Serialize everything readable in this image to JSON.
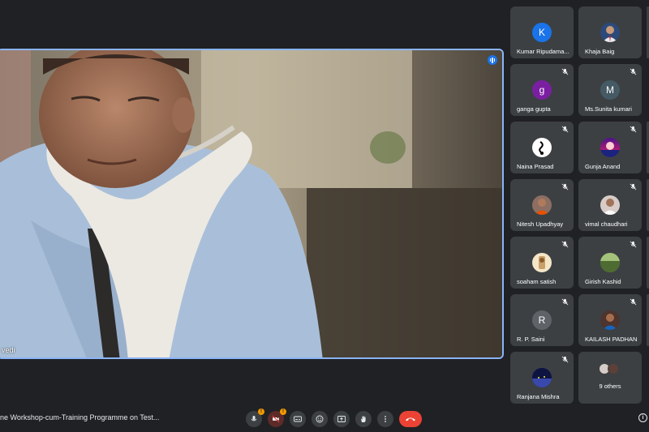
{
  "main_speaker": {
    "name_partial": "vedi"
  },
  "participants": [
    {
      "name": "Kumar Ripudama...",
      "initial": "K",
      "avatar_color": "#1a73e8",
      "muted": false,
      "photo": false
    },
    {
      "name": "Khaja Baig",
      "initial": "",
      "avatar_color": "#2b4a7a",
      "muted": false,
      "photo": true
    },
    {
      "name": "ganga gupta",
      "initial": "g",
      "avatar_color": "#7b1fa2",
      "muted": true,
      "photo": false
    },
    {
      "name": "Ms.Sunita kumari",
      "initial": "M",
      "avatar_color": "#455a64",
      "muted": true,
      "photo": false
    },
    {
      "name": "Naina Prasad",
      "initial": "",
      "avatar_color": "#ffffff",
      "muted": true,
      "photo": true
    },
    {
      "name": "Gunja Anand",
      "initial": "",
      "avatar_color": "#c2185b",
      "muted": true,
      "photo": true
    },
    {
      "name": "Nitesh Upadhyay",
      "initial": "",
      "avatar_color": "#8d6e63",
      "muted": true,
      "photo": true
    },
    {
      "name": "vimal chaudhari",
      "initial": "",
      "avatar_color": "#a1887f",
      "muted": true,
      "photo": true
    },
    {
      "name": "soaham satish",
      "initial": "",
      "avatar_color": "#c9a06a",
      "muted": true,
      "photo": true
    },
    {
      "name": "Girish Kashid",
      "initial": "",
      "avatar_color": "#6d8a4a",
      "muted": true,
      "photo": true
    },
    {
      "name": "R. P. Saini",
      "initial": "R",
      "avatar_color": "#5f6368",
      "muted": true,
      "photo": false
    },
    {
      "name": "KAILASH PADHAN",
      "initial": "",
      "avatar_color": "#4e342e",
      "muted": true,
      "photo": true
    },
    {
      "name": "Ranjana Mishra",
      "initial": "",
      "avatar_color": "#1a237e",
      "muted": true,
      "photo": true
    }
  ],
  "others_tile": {
    "label": "9 others"
  },
  "bottom_bar": {
    "meeting_title": "ne Workshop-cum-Training Programme on Test...",
    "mic_badge": "!",
    "camera_badge": "!"
  },
  "colors": {
    "background": "#202124",
    "tile": "#3c4043",
    "active_border": "#8ab4f8",
    "hangup": "#ea4335"
  }
}
